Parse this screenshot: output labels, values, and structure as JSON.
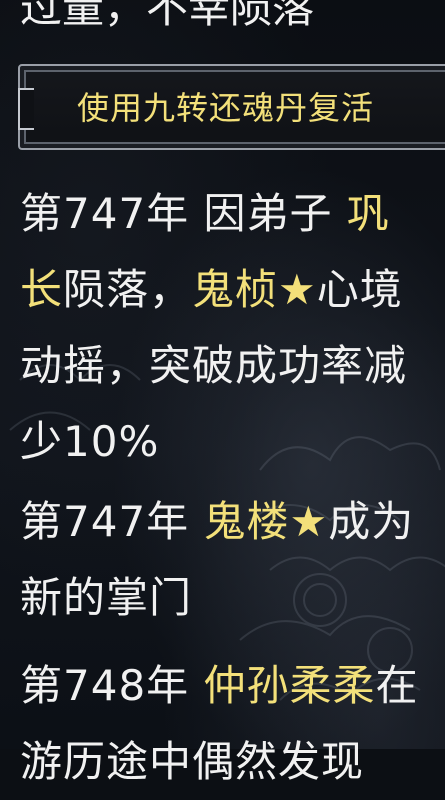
{
  "previous_entry_tail": "过量，不幸陨落",
  "revive_button": {
    "label": "使用九转还魂丹复活"
  },
  "entries": [
    {
      "year": "第747年",
      "text_a": " 因弟子 ",
      "name_a": "巩长",
      "text_b": "陨落，",
      "name_b": "鬼桢",
      "star": "★",
      "text_c": "心境动摇，突破成功率减少10%"
    },
    {
      "year": "第747年",
      "text_a": " ",
      "name_a": "鬼楼",
      "star": "★",
      "text_b": "成为新的掌门"
    },
    {
      "year": "第748年",
      "text_a": " ",
      "name_a": "仲孙柔柔",
      "text_b": "在游历途中偶然发现"
    }
  ],
  "colors": {
    "highlight": "#f3e07a",
    "text": "#f1f1f1",
    "background": "#0c0f14"
  }
}
